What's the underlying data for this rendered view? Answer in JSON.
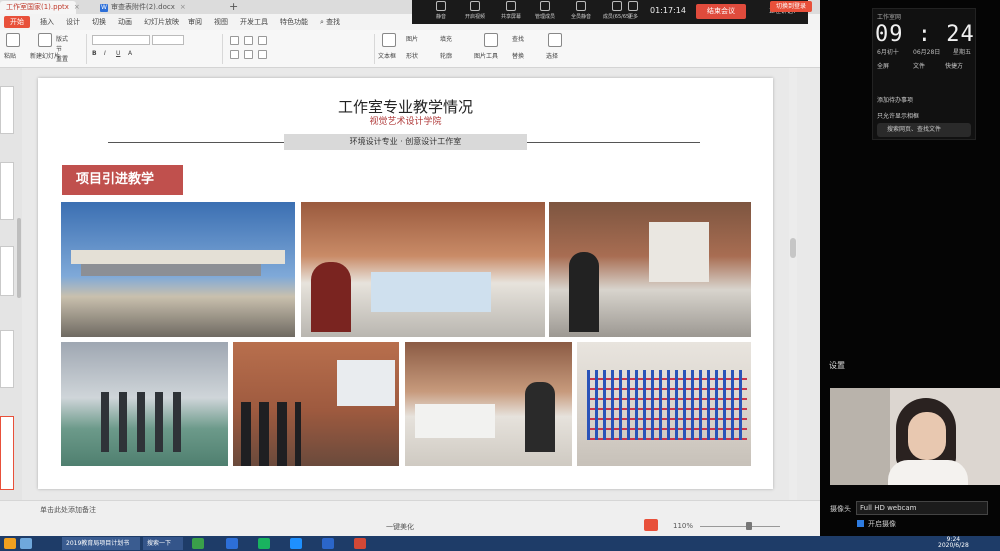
{
  "tabs": {
    "active": "工作室国家(1).pptx",
    "other": "审查表附件(2).docx",
    "new_tab": "+"
  },
  "menu": [
    "开始",
    "插入",
    "设计",
    "切换",
    "动画",
    "幻灯片放映",
    "审阅",
    "视图",
    "开发工具",
    "特色功能",
    "查找"
  ],
  "ribbon": {
    "paste": "粘贴",
    "format": "格式刷",
    "new_slide": "新建幻灯片",
    "layout": "版式",
    "section": "节",
    "reset": "重置",
    "textbox": "文本框",
    "shape": "形状",
    "arrange": "排列",
    "picture": "图片",
    "fill": "填充",
    "outline": "轮廓",
    "drawing_tools": "图片工具",
    "find": "查找",
    "replace": "替换",
    "select": "选择"
  },
  "meeting": {
    "buttons": [
      "静音",
      "开启视频",
      "共享屏幕",
      "管理成员",
      "全员静音",
      "成员(65/65)",
      "更多"
    ],
    "time": "01:17:14",
    "leave": "结束会议",
    "info": "正在讲话：",
    "user": "切换到登录"
  },
  "slide": {
    "title": "工作室专业教学情况",
    "subtitle": "视觉艺术设计学院",
    "banner": "环境设计专业 · 创意设计工作室",
    "section": "项目引进教学"
  },
  "status": {
    "notes": "单击此处添加备注",
    "beautify": "一键美化",
    "zoom": "110%"
  },
  "widget": {
    "status": "工作室网",
    "time": "09 : 24",
    "date": "6月初十",
    "month_day": "06月28日",
    "weekday": "星期五",
    "btn_fullscreen": "全屏",
    "btn_file": "文件",
    "btn_shortcut": "快捷方",
    "btn_add": "添加待办事项",
    "btn_notice": "只允许显示相框",
    "search": "搜索网页、查找文件"
  },
  "settings": {
    "label": "设置",
    "camera_label": "摄像头",
    "camera_value": "Full HD webcam",
    "enable_label": "开启摄像"
  },
  "taskbar": {
    "task1": "2019教育局项目计划书",
    "task2": "搜索一下",
    "clock_time": "9:24",
    "clock_date": "2020/6/28"
  }
}
